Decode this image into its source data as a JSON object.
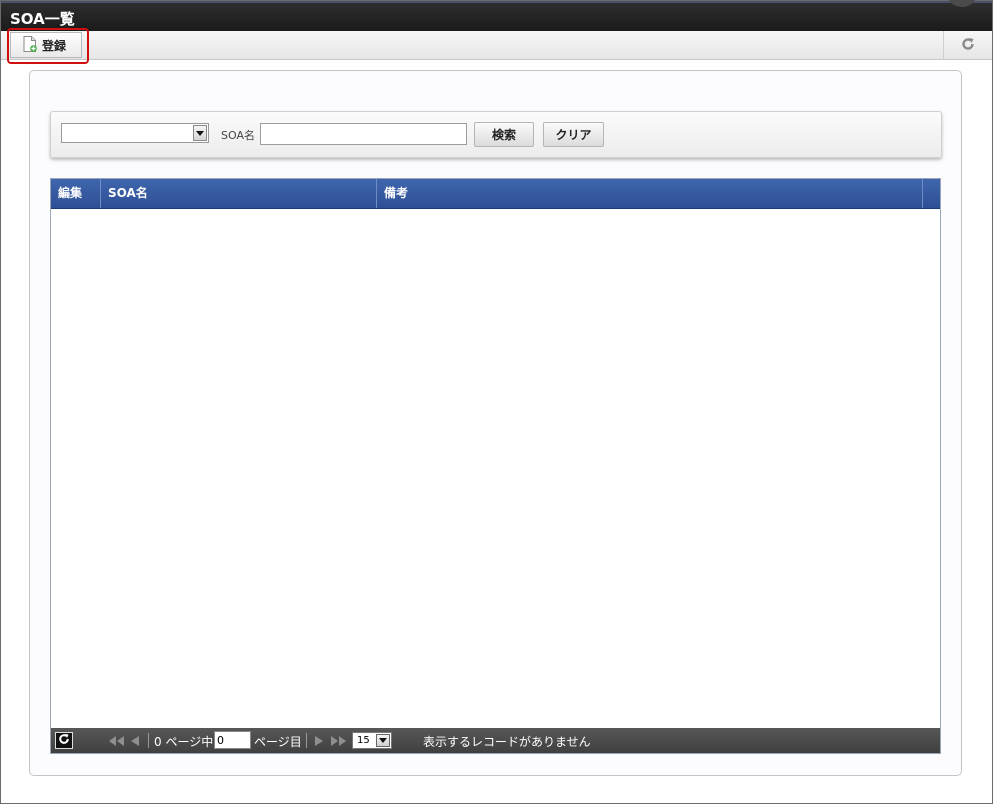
{
  "window": {
    "title": "SOA一覧"
  },
  "toolbar": {
    "register_label": "登録",
    "refresh_icon": "refresh-icon"
  },
  "search": {
    "select_value": "",
    "soa_name_label": "SOA名",
    "soa_name_value": "",
    "search_button": "検索",
    "clear_button": "クリア"
  },
  "grid": {
    "columns": [
      "編集",
      "SOA名",
      "備考"
    ],
    "rows": []
  },
  "pager": {
    "total_pages_text": "0 ページ中",
    "current_page": "0",
    "page_suffix": "ページ目",
    "page_size": "15",
    "status": "表示するレコードがありません"
  },
  "colors": {
    "header_blue": "#2e4f96",
    "highlight_red": "#d01010",
    "titlebar": "#1b1b1b"
  }
}
